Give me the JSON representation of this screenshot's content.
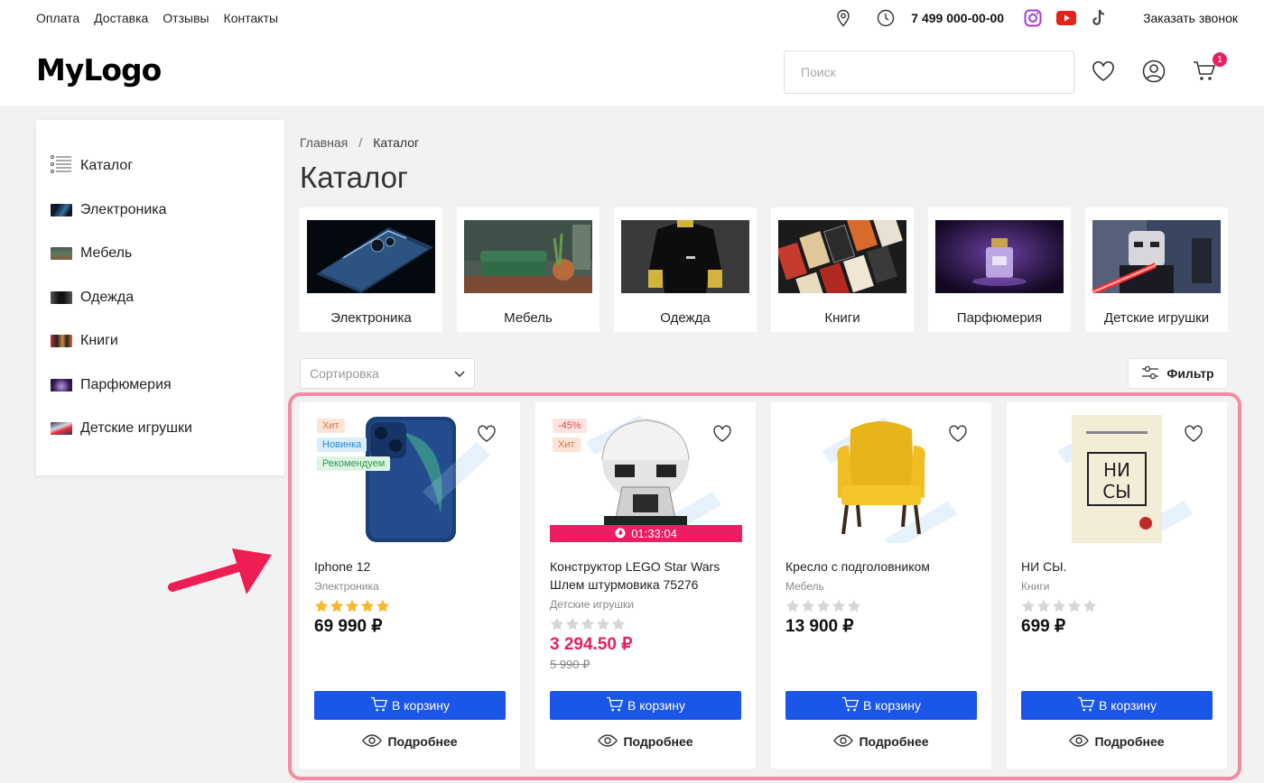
{
  "topnav": [
    "Оплата",
    "Доставка",
    "Отзывы",
    "Контакты"
  ],
  "contact": {
    "phone": "7 499 000-00-00",
    "callback": "Заказать звонок"
  },
  "logo": "MyLogo",
  "search": {
    "placeholder": "Поиск"
  },
  "cart": {
    "count": "1"
  },
  "sidebar": {
    "title": "Каталог",
    "items": [
      "Электроника",
      "Мебель",
      "Одежда",
      "Книги",
      "Парфюмерия",
      "Детские игрушки"
    ]
  },
  "breadcrumb": {
    "home": "Главная",
    "sep": "/",
    "current": "Каталог"
  },
  "page_title": "Каталог",
  "categories": [
    "Электроника",
    "Мебель",
    "Одежда",
    "Книги",
    "Парфюмерия",
    "Детские игрушки"
  ],
  "sort": {
    "placeholder": "Сортировка"
  },
  "filter": {
    "label": "Фильтр"
  },
  "products": [
    {
      "name": "Iphone 12",
      "category": "Электроника",
      "rating": 5,
      "price": "69 990 ₽",
      "old_price": "",
      "tags": [
        "Хит",
        "Новинка",
        "Рекомендуем"
      ]
    },
    {
      "name": "Конструктор LEGO Star Wars Шлем штурмовика 75276",
      "category": "Детские игрушки",
      "rating": 0,
      "price": "3 294.50 ₽",
      "old_price": "5 990 ₽",
      "tags": [
        "-45%",
        "Хит"
      ],
      "timer": "01:33:04"
    },
    {
      "name": "Кресло с подголовником",
      "category": "Мебель",
      "rating": 0,
      "price": "13 900 ₽",
      "old_price": "",
      "tags": []
    },
    {
      "name": "НИ СЫ.",
      "category": "Книги",
      "rating": 0,
      "price": "699 ₽",
      "old_price": "",
      "tags": []
    }
  ],
  "buttons": {
    "add_to_cart": "В корзину",
    "details": "Подробнее"
  },
  "colors": {
    "accent": "#1a56e8",
    "sale": "#e91e63",
    "highlight": "#f28ba4",
    "star": "#f5b82e"
  }
}
